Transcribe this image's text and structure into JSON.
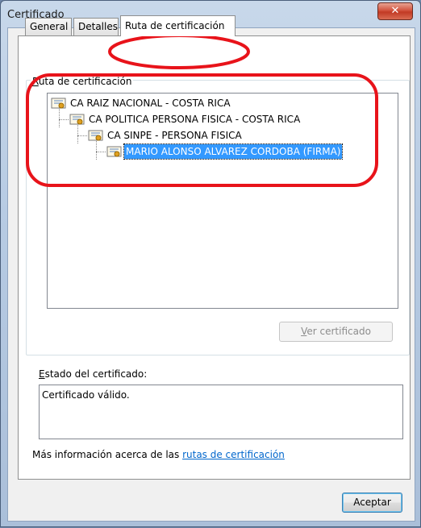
{
  "window": {
    "title": "Certificado"
  },
  "tabs": [
    {
      "label": "General"
    },
    {
      "label": "Detalles"
    },
    {
      "label": "Ruta de certificación"
    }
  ],
  "cert_path": {
    "group_label_accel": "R",
    "group_label_rest": "uta de certificación",
    "tree": [
      {
        "label": "CA RAIZ NACIONAL - COSTA RICA"
      },
      {
        "label": "CA POLITICA PERSONA FISICA - COSTA RICA"
      },
      {
        "label": "CA SINPE - PERSONA FISICA"
      },
      {
        "label": "MARIO ALONSO ALVAREZ CORDOBA (FIRMA)",
        "selected": true
      }
    ],
    "view_button_accel": "V",
    "view_button_rest": "er certificado"
  },
  "status": {
    "label_accel": "E",
    "label_rest": "stado del certificado:",
    "value": "Certificado válido."
  },
  "more_info": {
    "prefix": "Más información acerca de las ",
    "link": "rutas de certificación"
  },
  "accept_label": "Aceptar",
  "colors": {
    "selection": "#3399ff",
    "annotation": "#e8131a",
    "link": "#0066cc"
  },
  "icons": [
    "close-icon",
    "certificate-icon"
  ]
}
